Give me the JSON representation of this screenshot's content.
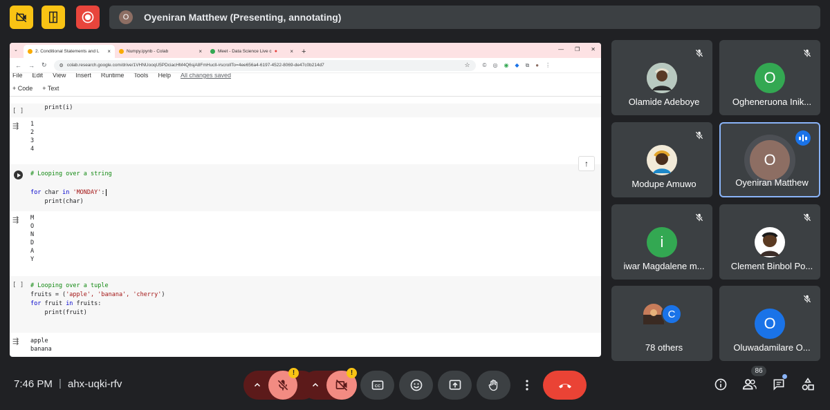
{
  "presenter": {
    "avatar_letter": "O",
    "label": "Oyeniran Matthew (Presenting, annotating)"
  },
  "browser": {
    "tabs": [
      {
        "label": "2. Conditional Statements and L",
        "active": true
      },
      {
        "label": "Numpy.ipynb - Colab",
        "active": false
      },
      {
        "label": "Meet - Data Science Live c",
        "active": false
      }
    ],
    "url": "colab.research.google.com/drive/1VHNUooqU5PDciacHM4Q6sjA8FmHucll-#scrollTo=4ee656a4-6197-4522-8069-de47c0b214d7"
  },
  "colab": {
    "menu": [
      "File",
      "Edit",
      "View",
      "Insert",
      "Runtime",
      "Tools",
      "Help"
    ],
    "saved_status": "All changes saved",
    "toolbar": {
      "code": "+ Code",
      "text": "+ Text"
    },
    "cell1": {
      "gutter": "[ ]",
      "line": "    print(i)"
    },
    "out1": [
      "1",
      "2",
      "3",
      "4"
    ],
    "cell2": {
      "comment": "# Looping over a string",
      "kw_for": "for",
      "var": " char ",
      "kw_in": "in",
      "str": " 'MONDAY'",
      "colon": ":",
      "body": "    print(char)"
    },
    "out2": [
      "M",
      "O",
      "N",
      "D",
      "A",
      "Y"
    ],
    "cell3": {
      "gutter": "[ ]",
      "comment": "# Looping over a tuple",
      "line2a": "fruits = (",
      "line2b": "'apple', 'banana', 'cherry'",
      "line2c": ")",
      "kw_for": "for",
      "var": " fruit ",
      "kw_in": "in",
      "rest": " fruits:",
      "body": "    print(fruit)"
    },
    "out3": [
      "apple",
      "banana"
    ]
  },
  "participants": [
    {
      "name": "Olamide Adeboye",
      "avatar": "",
      "color": "#c9b9a3"
    },
    {
      "name": "Ogheneruona Inik...",
      "avatar": "O",
      "color": "#33a852"
    },
    {
      "name": "Modupe Amuwo",
      "avatar": "",
      "color": "#d8c6a8"
    },
    {
      "name": "Oyeniran Matthew",
      "avatar": "O",
      "color": "#8d6e63"
    },
    {
      "name": "iwar Magdalene m...",
      "avatar": "i",
      "color": "#33a852"
    },
    {
      "name": "Clement Binbol Po...",
      "avatar": "",
      "color": "#7a5230"
    },
    {
      "name": "78 others",
      "avatar": "C",
      "color": "#1a73e8"
    },
    {
      "name": "Oluwadamilare O...",
      "avatar": "O",
      "color": "#1a73e8"
    }
  ],
  "bottom": {
    "time": "7:46 PM",
    "separator": "|",
    "meeting_code": "ahx-uqki-rfv",
    "participant_count": "86",
    "warn": "!"
  }
}
